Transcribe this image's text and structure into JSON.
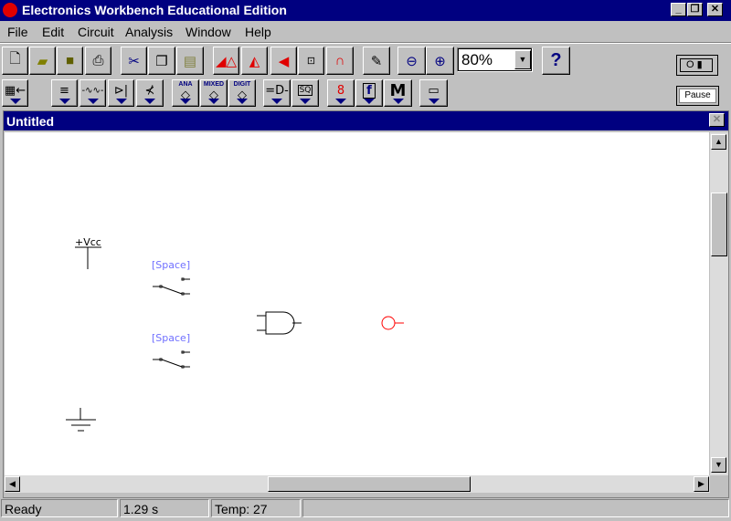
{
  "app": {
    "title": "Electronics Workbench Educational Edition"
  },
  "menu": [
    "File",
    "Edit",
    "Circuit",
    "Analysis",
    "Window",
    "Help"
  ],
  "toolbar1": [
    "new-icon",
    "open-icon",
    "save-icon",
    "print-icon",
    "cut-icon",
    "copy-icon",
    "paste-icon",
    "rotate-icon",
    "flip-horizontal-icon",
    "flip-vertical-icon",
    "subcircuit-icon",
    "graph-icon",
    "description-icon",
    "zoom-out-icon",
    "zoom-in-icon",
    "help-icon"
  ],
  "zoom": {
    "value": "80%"
  },
  "help_label": "?",
  "toolbar2": {
    "ana": "ANA",
    "mixed": "MIXED",
    "digit": "DIGIT",
    "misc": "M"
  },
  "pause_label": "Pause",
  "document": {
    "title": "Untitled"
  },
  "schematic": {
    "vcc_label": "+Vcc",
    "switch1_key": "[Space]",
    "switch2_key": "[Space]",
    "probe_color": "#ff0000",
    "key_color": "#7070ff"
  },
  "status": {
    "state": "Ready",
    "time": "1.29 s",
    "temp": "Temp: 27"
  }
}
